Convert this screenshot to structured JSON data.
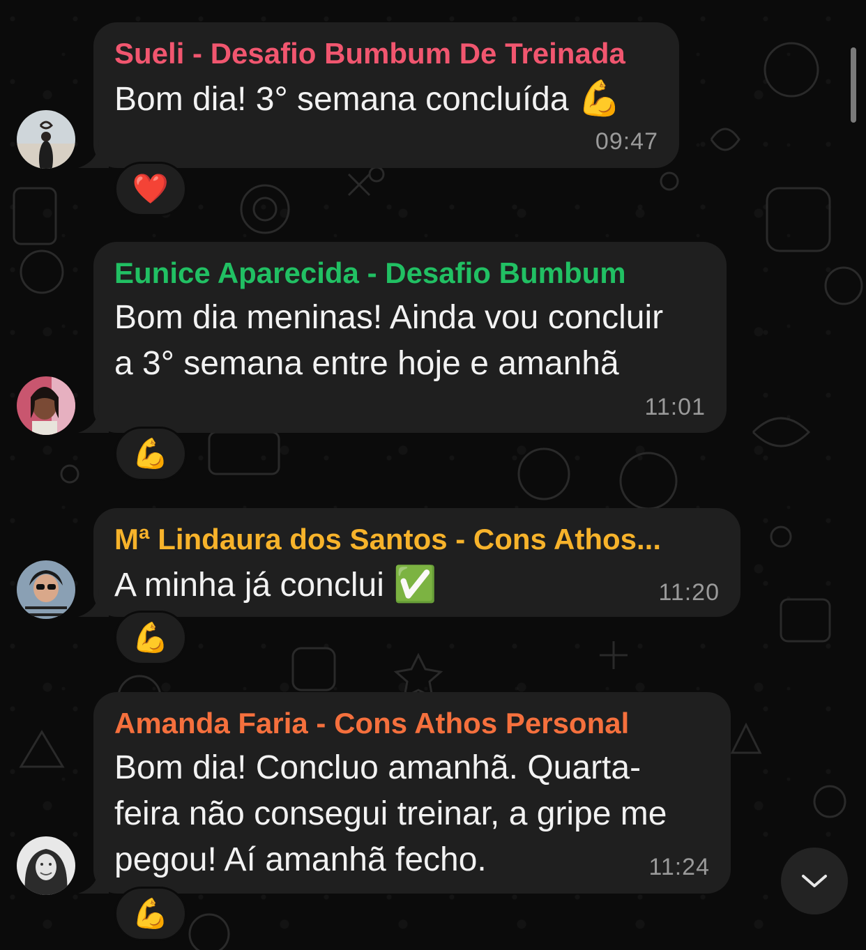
{
  "messages": [
    {
      "sender": "Sueli - Desafio Bumbum De Treinada",
      "sender_color": "#f1566f",
      "text": "Bom dia! 3° semana concluída",
      "emoji": "💪",
      "time": "09:47",
      "reaction": "❤️"
    },
    {
      "sender": "Eunice Aparecida - Desafio Bumbum",
      "sender_color": "#21c063",
      "text_line1": "Bom dia meninas! Ainda vou concluir",
      "text_line2": "a 3° semana entre hoje e amanhã",
      "time": "11:01",
      "reaction": "💪"
    },
    {
      "sender": "Mª Lindaura dos Santos - Cons Athos...",
      "sender_color": "#f7b32b",
      "text": "A minha já conclui",
      "emoji": "✅",
      "time": "11:20",
      "reaction": "💪"
    },
    {
      "sender": "Amanda Faria - Cons Athos Personal",
      "sender_color": "#f5703d",
      "text_line1": "Bom dia! Concluo amanhã. Quarta-",
      "text_line2": "feira não consegui treinar, a gripe me",
      "text_line3": "pegou! Aí amanhã fecho.",
      "time": "11:24",
      "reaction": "💪"
    }
  ],
  "scroll_down_icon": "chevron-down-icon",
  "colors": {
    "bubble": "#1f1f1f",
    "background": "#0b0b0b",
    "timestamp": "#9a9a9a"
  }
}
